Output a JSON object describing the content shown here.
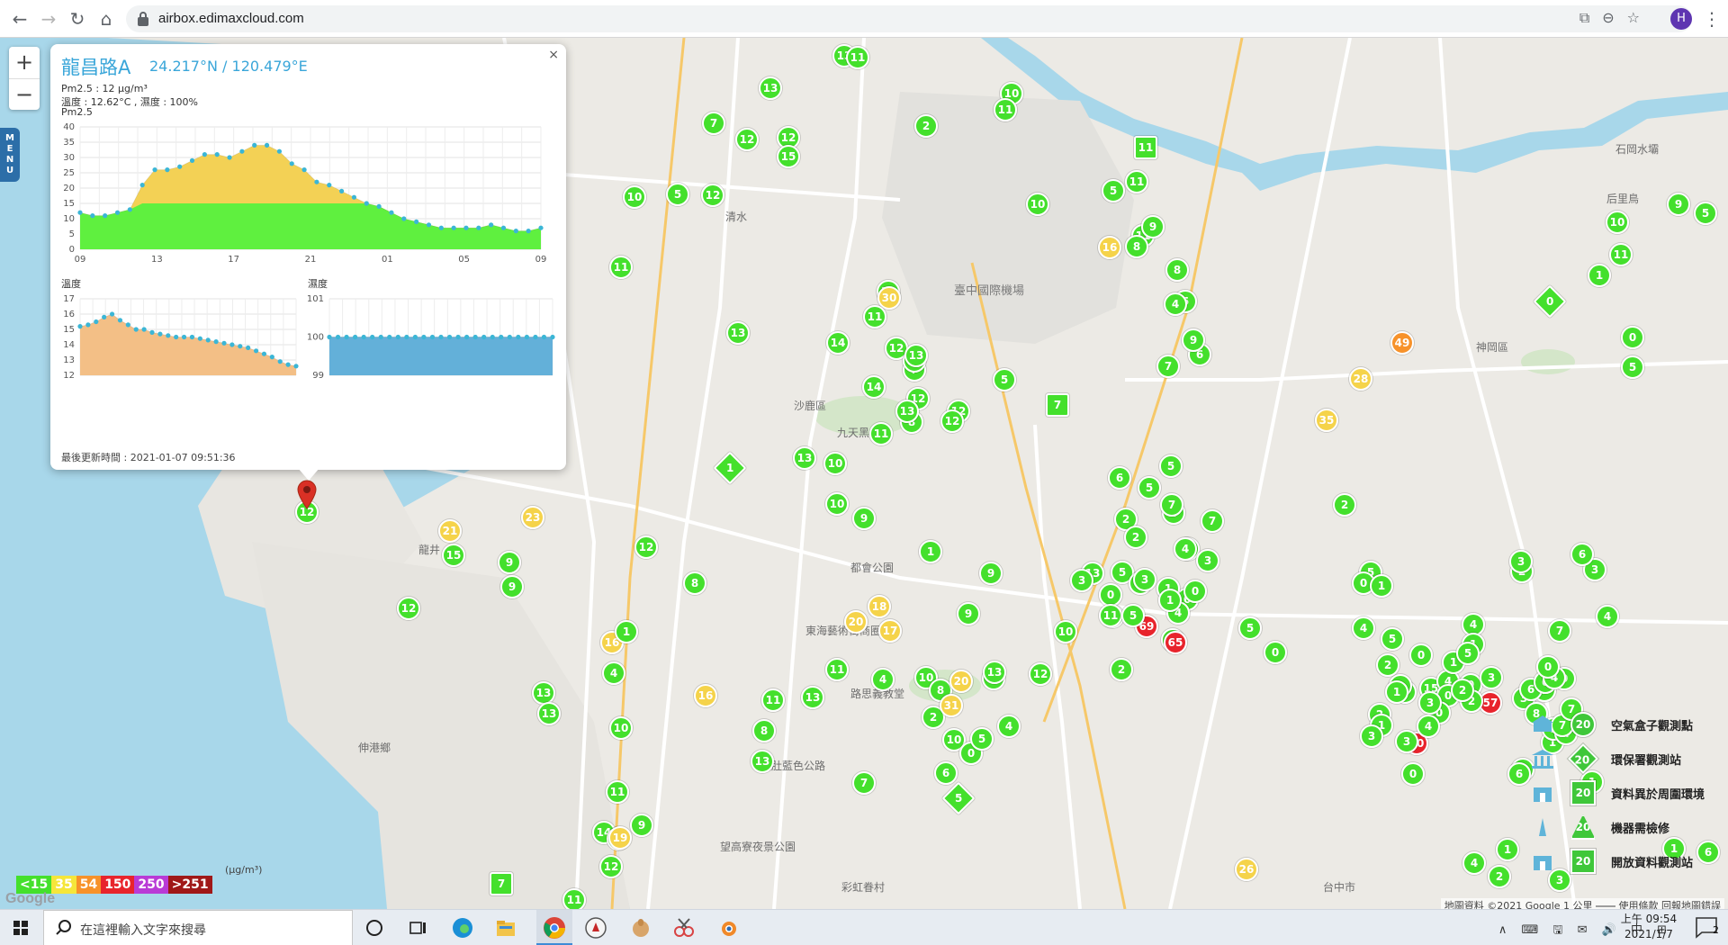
{
  "browser": {
    "url": "airbox.edimaxcloud.com",
    "avatar_letter": "H"
  },
  "map": {
    "zoom_in": "+",
    "zoom_out": "−",
    "menu_label": "MENU",
    "place_labels": [
      "臺中國際機場",
      "沙鹿區",
      "九天黑森林",
      "神岡區",
      "都會公園",
      "東海藝術街商圈",
      "路思義教堂",
      "大肚藍色公路",
      "伸港鄉",
      "望高寮夜景公園",
      "彩虹眷村",
      "清水",
      "龍井",
      "台中市",
      "后里鳥",
      "石岡水壩"
    ]
  },
  "markers": [
    {
      "v": "13",
      "c": "#44e02c"
    },
    {
      "v": "11",
      "c": "#44e02c"
    },
    {
      "v": "13",
      "c": "#44e02c"
    },
    {
      "v": "10",
      "c": "#44e02c"
    },
    {
      "v": "11",
      "c": "#44e02c"
    },
    {
      "v": "2",
      "c": "#44e02c"
    },
    {
      "v": "7",
      "c": "#44e02c"
    },
    {
      "v": "12",
      "c": "#44e02c"
    },
    {
      "v": "12",
      "c": "#44e02c"
    },
    {
      "v": "15",
      "c": "#44e02c"
    },
    {
      "v": "5",
      "c": "#44e02c"
    },
    {
      "v": "12",
      "c": "#44e02c"
    },
    {
      "v": "10",
      "c": "#44e02c"
    },
    {
      "v": "11",
      "c": "#44e02c"
    },
    {
      "v": "13",
      "c": "#44e02c"
    },
    {
      "v": "12",
      "c": "#44e02c"
    },
    {
      "v": "14",
      "c": "#44e02c"
    },
    {
      "v": "7",
      "c": "#44e02c"
    },
    {
      "v": "5",
      "c": "#44e02c"
    },
    {
      "v": "12",
      "c": "#44e02c"
    },
    {
      "v": "12",
      "c": "#44e02c"
    },
    {
      "v": "8",
      "c": "#44e02c"
    },
    {
      "v": "10",
      "c": "#44e02c"
    },
    {
      "v": "11",
      "c": "#44e02c"
    },
    {
      "v": "16",
      "c": "#f5d34a"
    },
    {
      "v": "30",
      "c": "#f5d34a"
    },
    {
      "v": "11",
      "c": "#44e02c"
    },
    {
      "v": "12",
      "c": "#44e02c"
    },
    {
      "v": "13",
      "c": "#44e02c"
    },
    {
      "v": "14",
      "c": "#44e02c"
    },
    {
      "v": "13",
      "c": "#44e02c"
    },
    {
      "v": "12",
      "c": "#44e02c"
    },
    {
      "v": "13",
      "c": "#44e02c"
    },
    {
      "v": "11",
      "c": "#44e02c"
    },
    {
      "v": "10",
      "c": "#44e02c"
    },
    {
      "v": "13",
      "c": "#44e02c"
    },
    {
      "v": "10",
      "c": "#44e02c"
    },
    {
      "v": "9",
      "c": "#44e02c"
    },
    {
      "v": "1",
      "c": "#44e02c"
    },
    {
      "v": "9",
      "c": "#44e02c"
    },
    {
      "v": "12",
      "c": "#44e02c"
    },
    {
      "v": "16",
      "c": "#f5d34a"
    },
    {
      "v": "23",
      "c": "#f5d34a"
    },
    {
      "v": "21",
      "c": "#f5d34a"
    },
    {
      "v": "15",
      "c": "#44e02c"
    },
    {
      "v": "13",
      "c": "#44e02c"
    },
    {
      "v": "12",
      "c": "#44e02c"
    },
    {
      "v": "9",
      "c": "#44e02c"
    },
    {
      "v": "9",
      "c": "#44e02c"
    },
    {
      "v": "12",
      "c": "#44e02c"
    },
    {
      "v": "8",
      "c": "#44e02c"
    },
    {
      "v": "1",
      "c": "#44e02c"
    },
    {
      "v": "4",
      "c": "#44e02c"
    },
    {
      "v": "16",
      "c": "#f5d34a"
    },
    {
      "v": "10",
      "c": "#44e02c"
    },
    {
      "v": "13",
      "c": "#44e02c"
    },
    {
      "v": "11",
      "c": "#44e02c"
    },
    {
      "v": "13",
      "c": "#44e02c"
    },
    {
      "v": "11",
      "c": "#44e02c"
    },
    {
      "v": "8",
      "c": "#44e02c"
    },
    {
      "v": "13",
      "c": "#44e02c"
    },
    {
      "v": "11",
      "c": "#44e02c"
    },
    {
      "v": "14",
      "c": "#44e02c"
    },
    {
      "v": "9",
      "c": "#44e02c"
    },
    {
      "v": "9",
      "c": "#44e02c"
    },
    {
      "v": "12",
      "c": "#44e02c"
    },
    {
      "v": "11",
      "c": "#44e02c"
    },
    {
      "v": "19",
      "c": "#f5d34a"
    },
    {
      "v": "7",
      "c": "#44e02c"
    },
    {
      "v": "18",
      "c": "#f5d34a"
    },
    {
      "v": "20",
      "c": "#f5d34a"
    },
    {
      "v": "17",
      "c": "#f5d34a"
    },
    {
      "v": "4",
      "c": "#44e02c"
    },
    {
      "v": "10",
      "c": "#44e02c"
    },
    {
      "v": "8",
      "c": "#44e02c"
    },
    {
      "v": "2",
      "c": "#44e02c"
    },
    {
      "v": "10",
      "c": "#44e02c"
    },
    {
      "v": "6",
      "c": "#44e02c"
    },
    {
      "v": "31",
      "c": "#f5d34a"
    },
    {
      "v": "0",
      "c": "#44e02c"
    },
    {
      "v": "4",
      "c": "#44e02c"
    },
    {
      "v": "7",
      "c": "#44e02c"
    },
    {
      "v": "20",
      "c": "#f5d34a"
    },
    {
      "v": "13",
      "c": "#44e02c"
    },
    {
      "v": "9",
      "c": "#44e02c"
    },
    {
      "v": "5",
      "c": "#44e02c"
    },
    {
      "v": "10",
      "c": "#44e02c"
    },
    {
      "v": "8",
      "c": "#44e02c"
    },
    {
      "v": "2",
      "c": "#44e02c"
    },
    {
      "v": "0",
      "c": "#44e02c"
    },
    {
      "v": "5",
      "c": "#44e02c"
    },
    {
      "v": "2",
      "c": "#44e02c"
    },
    {
      "v": "4",
      "c": "#44e02c"
    },
    {
      "v": "6",
      "c": "#44e02c"
    },
    {
      "v": "11",
      "c": "#44e02c"
    },
    {
      "v": "7",
      "c": "#44e02c"
    },
    {
      "v": "13",
      "c": "#44e02c"
    },
    {
      "v": "5",
      "c": "#44e02c"
    },
    {
      "v": "69",
      "c": "#e8242c"
    },
    {
      "v": "4",
      "c": "#44e02c"
    },
    {
      "v": "65",
      "c": "#e8242c"
    },
    {
      "v": "90",
      "c": "#e8242c"
    },
    {
      "v": "57",
      "c": "#e8242c"
    },
    {
      "v": "26",
      "c": "#f5d34a"
    },
    {
      "v": "49",
      "c": "#f7922a"
    },
    {
      "v": "28",
      "c": "#f5d34a"
    },
    {
      "v": "35",
      "c": "#f5d34a"
    },
    {
      "v": "11",
      "c": "#44e02c"
    },
    {
      "v": "5",
      "c": "#44e02c"
    },
    {
      "v": "9",
      "c": "#44e02c"
    },
    {
      "v": "8",
      "c": "#44e02c"
    },
    {
      "v": "8",
      "c": "#44e02c"
    },
    {
      "v": "5",
      "c": "#44e02c"
    },
    {
      "v": "4",
      "c": "#44e02c"
    },
    {
      "v": "6",
      "c": "#44e02c"
    },
    {
      "v": "9",
      "c": "#44e02c"
    },
    {
      "v": "7",
      "c": "#44e02c"
    },
    {
      "v": "6",
      "c": "#44e02c"
    },
    {
      "v": "5",
      "c": "#44e02c"
    },
    {
      "v": "5",
      "c": "#44e02c"
    },
    {
      "v": "7",
      "c": "#44e02c"
    },
    {
      "v": "2",
      "c": "#44e02c"
    },
    {
      "v": "3",
      "c": "#44e02c"
    },
    {
      "v": "3",
      "c": "#44e02c"
    },
    {
      "v": "5",
      "c": "#44e02c"
    },
    {
      "v": "4",
      "c": "#44e02c"
    },
    {
      "v": "2",
      "c": "#44e02c"
    },
    {
      "v": "4",
      "c": "#44e02c"
    },
    {
      "v": "3",
      "c": "#44e02c"
    },
    {
      "v": "1",
      "c": "#44e02c"
    },
    {
      "v": "3",
      "c": "#44e02c"
    },
    {
      "v": "1",
      "c": "#44e02c"
    },
    {
      "v": "0",
      "c": "#44e02c"
    },
    {
      "v": "0",
      "c": "#44e02c"
    },
    {
      "v": "2",
      "c": "#44e02c"
    },
    {
      "v": "5",
      "c": "#44e02c"
    },
    {
      "v": "0",
      "c": "#44e02c"
    },
    {
      "v": "1",
      "c": "#44e02c"
    },
    {
      "v": "4",
      "c": "#44e02c"
    },
    {
      "v": "5",
      "c": "#44e02c"
    },
    {
      "v": "2",
      "c": "#44e02c"
    },
    {
      "v": "2",
      "c": "#44e02c"
    },
    {
      "v": "1",
      "c": "#44e02c"
    },
    {
      "v": "15",
      "c": "#44e02c"
    },
    {
      "v": "4",
      "c": "#44e02c"
    },
    {
      "v": "0",
      "c": "#44e02c"
    },
    {
      "v": "2",
      "c": "#44e02c"
    },
    {
      "v": "1",
      "c": "#44e02c"
    },
    {
      "v": "3",
      "c": "#44e02c"
    },
    {
      "v": "0",
      "c": "#44e02c"
    },
    {
      "v": "1",
      "c": "#44e02c"
    },
    {
      "v": "0",
      "c": "#44e02c"
    },
    {
      "v": "3",
      "c": "#44e02c"
    },
    {
      "v": "0",
      "c": "#44e02c"
    },
    {
      "v": "1",
      "c": "#44e02c"
    },
    {
      "v": "2",
      "c": "#44e02c"
    },
    {
      "v": "3",
      "c": "#44e02c"
    },
    {
      "v": "1",
      "c": "#44e02c"
    },
    {
      "v": "4",
      "c": "#44e02c"
    },
    {
      "v": "6",
      "c": "#44e02c"
    },
    {
      "v": "8",
      "c": "#44e02c"
    },
    {
      "v": "7",
      "c": "#44e02c"
    },
    {
      "v": "6",
      "c": "#44e02c"
    },
    {
      "v": "4",
      "c": "#44e02c"
    },
    {
      "v": "7",
      "c": "#44e02c"
    },
    {
      "v": "6",
      "c": "#44e02c"
    },
    {
      "v": "8",
      "c": "#44e02c"
    },
    {
      "v": "7",
      "c": "#44e02c"
    },
    {
      "v": "0",
      "c": "#44e02c"
    },
    {
      "v": "4",
      "c": "#44e02c"
    },
    {
      "v": "0",
      "c": "#44e02c"
    },
    {
      "v": "7",
      "c": "#44e02c"
    },
    {
      "v": "4",
      "c": "#44e02c"
    },
    {
      "v": "3",
      "c": "#44e02c"
    },
    {
      "v": "6",
      "c": "#44e02c"
    },
    {
      "v": "2",
      "c": "#44e02c"
    },
    {
      "v": "3",
      "c": "#44e02c"
    },
    {
      "v": "4",
      "c": "#44e02c"
    },
    {
      "v": "1",
      "c": "#44e02c"
    },
    {
      "v": "5",
      "c": "#44e02c"
    },
    {
      "v": "3",
      "c": "#44e02c"
    },
    {
      "v": "2",
      "c": "#44e02c"
    },
    {
      "v": "4",
      "c": "#44e02c"
    },
    {
      "v": "3",
      "c": "#44e02c"
    },
    {
      "v": "0",
      "c": "#44e02c"
    },
    {
      "v": "1",
      "c": "#44e02c"
    },
    {
      "v": "4",
      "c": "#44e02c"
    },
    {
      "v": "2",
      "c": "#44e02c"
    },
    {
      "v": "0",
      "c": "#44e02c"
    },
    {
      "v": "1",
      "c": "#44e02c"
    },
    {
      "v": "3",
      "c": "#44e02c"
    },
    {
      "v": "1",
      "c": "#44e02c"
    },
    {
      "v": "1",
      "c": "#44e02c"
    },
    {
      "v": "6",
      "c": "#44e02c"
    },
    {
      "v": "9",
      "c": "#44e02c"
    },
    {
      "v": "5",
      "c": "#44e02c"
    },
    {
      "v": "10",
      "c": "#44e02c"
    },
    {
      "v": "11",
      "c": "#44e02c"
    },
    {
      "v": "1",
      "c": "#44e02c"
    },
    {
      "v": "0",
      "c": "#44e02c"
    },
    {
      "v": "5",
      "c": "#44e02c"
    }
  ],
  "special_markers": [
    {
      "v": "11",
      "shape": "sq"
    },
    {
      "v": "1",
      "shape": "dia"
    },
    {
      "v": "7",
      "shape": "sq"
    },
    {
      "v": "0",
      "shape": "dia"
    },
    {
      "v": "5",
      "shape": "dia"
    },
    {
      "v": "7",
      "shape": "sq"
    }
  ],
  "popup": {
    "close": "×",
    "station_name": "龍昌路A",
    "coords": "24.217°N / 120.479°E",
    "pm25_reading": "Pm2.5 : 12 μg/m³",
    "temp_humidity": "溫度 : 12.62°C , 濕度 : 100%",
    "pm25_chart_label": "Pm2.5",
    "temp_chart_label": "溫度",
    "humidity_chart_label": "濕度",
    "updated": "最後更新時間 : 2021-01-07 09:51:36"
  },
  "chart_data": [
    {
      "type": "area",
      "title": "Pm2.5",
      "x_ticks": [
        "09",
        "13",
        "17",
        "21",
        "01",
        "05",
        "09"
      ],
      "y_ticks": [
        0,
        5,
        10,
        15,
        20,
        25,
        30,
        35,
        40
      ],
      "ylim": [
        0,
        40
      ],
      "threshold": 15,
      "colors": {
        "below": "#5ff03f",
        "above": "#f3d155",
        "points": "#3bb6d6"
      },
      "values": [
        12,
        11,
        11,
        12,
        13,
        21,
        26,
        26,
        27,
        29,
        31,
        31,
        30,
        32,
        34,
        34,
        32,
        28,
        26,
        22,
        21,
        19,
        17,
        15,
        14,
        12,
        10,
        9,
        8,
        7,
        7,
        7,
        7,
        8,
        7,
        6,
        6,
        7
      ]
    },
    {
      "type": "area",
      "title": "溫度",
      "y_ticks": [
        12,
        13,
        14,
        15,
        16,
        17
      ],
      "ylim": [
        12,
        17
      ],
      "colors": {
        "fill": "#f3bf86",
        "points": "#3bb6d6"
      },
      "values": [
        15.2,
        15.3,
        15.5,
        15.8,
        16.0,
        15.6,
        15.3,
        15.0,
        15.0,
        14.8,
        14.7,
        14.6,
        14.5,
        14.5,
        14.5,
        14.4,
        14.3,
        14.2,
        14.1,
        14.0,
        13.9,
        13.8,
        13.6,
        13.4,
        13.2,
        12.9,
        12.7,
        12.6
      ]
    },
    {
      "type": "area",
      "title": "濕度",
      "y_ticks": [
        99,
        100,
        101
      ],
      "ylim": [
        99,
        101
      ],
      "colors": {
        "fill": "#63b0d9",
        "points": "#3bb6d6"
      },
      "values": [
        100,
        100,
        100,
        100,
        100,
        100,
        100,
        100,
        100,
        100,
        100,
        100,
        100,
        100,
        100,
        100,
        100,
        100,
        100,
        100,
        100,
        100,
        100,
        100,
        100,
        100,
        100
      ]
    }
  ],
  "aqi_legend": {
    "unit": "(μg/m³)",
    "items": [
      {
        "label": "<15",
        "color": "#44e02c"
      },
      {
        "label": "35",
        "color": "#f5e63a"
      },
      {
        "label": "54",
        "color": "#f7922a"
      },
      {
        "label": "150",
        "color": "#e8242c"
      },
      {
        "label": "250",
        "color": "#b93bd6"
      },
      {
        "label": ">251",
        "color": "#a01818"
      }
    ]
  },
  "station_legend": [
    {
      "sym": "20",
      "label": "空氣盒子觀測點",
      "shape": "c"
    },
    {
      "sym": "20",
      "label": "環保署觀測站",
      "shape": "d"
    },
    {
      "sym": "20",
      "label": "資料異於周圍環境",
      "shape": "s"
    },
    {
      "sym": "20",
      "label": "機器需檢修",
      "shape": "t"
    },
    {
      "sym": "20",
      "label": "開放資料觀測站",
      "shape": "s"
    }
  ],
  "google_logo": "Google",
  "attribution": "地圖資料 ©2021 Google   1 公里 ⎯⎯⎯⎯   使用條款   回報地圖錯誤",
  "taskbar": {
    "search_placeholder": "在這裡輸入文字來搜尋",
    "tray_text": "∧ ⌨ 🖫 ✉ 🔊 中 ⊞",
    "time": "上午 09:54",
    "date": "2021/1/7",
    "notif_count": "2"
  }
}
